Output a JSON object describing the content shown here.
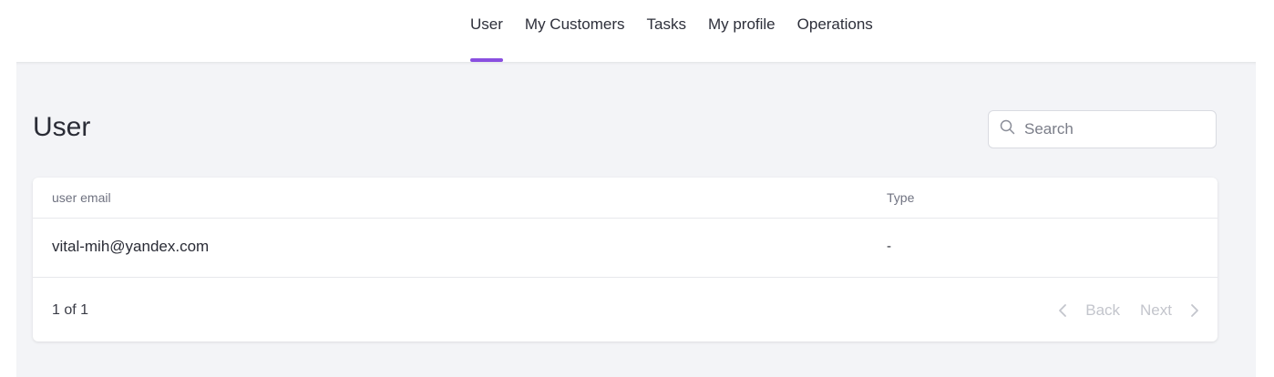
{
  "nav": {
    "items": [
      {
        "label": "User",
        "active": true
      },
      {
        "label": "My Customers",
        "active": false
      },
      {
        "label": "Tasks",
        "active": false
      },
      {
        "label": "My profile",
        "active": false
      },
      {
        "label": "Operations",
        "active": false
      }
    ],
    "accent_color": "#8a4fe0"
  },
  "page": {
    "title": "User"
  },
  "search": {
    "placeholder": "Search",
    "value": "",
    "icon": "search-icon"
  },
  "table": {
    "columns": [
      "user email",
      "Type"
    ],
    "rows": [
      {
        "email": "vital-mih@yandex.com",
        "type": "-"
      }
    ],
    "pagination": {
      "count_text": "1 of 1",
      "back_label": "Back",
      "next_label": "Next",
      "prev_icon": "chevron-left-icon",
      "next_icon": "chevron-right-icon"
    }
  }
}
